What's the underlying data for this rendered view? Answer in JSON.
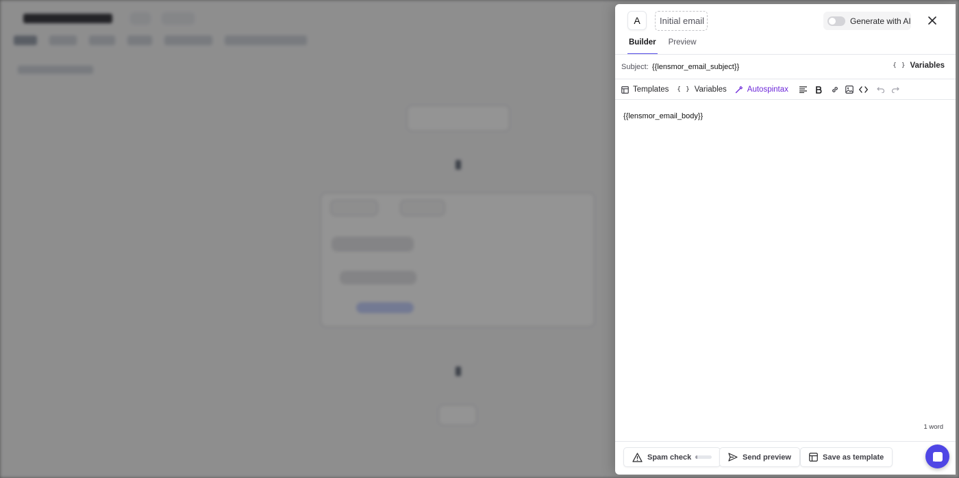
{
  "modal": {
    "avatar_letter": "A",
    "name_input": {
      "value": "Initial email"
    },
    "ai_toggle": {
      "label": "Generate with AI",
      "enabled": false
    },
    "close_icon": "close-icon",
    "tabs": [
      {
        "label": "Builder",
        "active": true
      },
      {
        "label": "Preview",
        "active": false
      }
    ],
    "subject": {
      "label": "Subject:",
      "value": "{{lensmor_email_subject}}",
      "variables_label": "Variables"
    },
    "toolbar": {
      "templates_label": "Templates",
      "variables_label": "Variables",
      "autospintax_label": "Autospintax",
      "icons": [
        "align-icon",
        "bold-icon",
        "link-icon",
        "image-icon",
        "code-icon",
        "undo-icon",
        "redo-icon"
      ]
    },
    "body": {
      "value": "{{lensmor_email_body}}"
    },
    "word_count": "1 word",
    "footer": {
      "spam_check_label": "Spam check",
      "spam_score": 0.1,
      "send_preview_label": "Send preview",
      "save_template_label": "Save as template"
    }
  },
  "colors": {
    "accent": "#4f46e5",
    "autospintax": "#6d28d9",
    "overlay": "rgba(0,0,0,0.42)"
  }
}
